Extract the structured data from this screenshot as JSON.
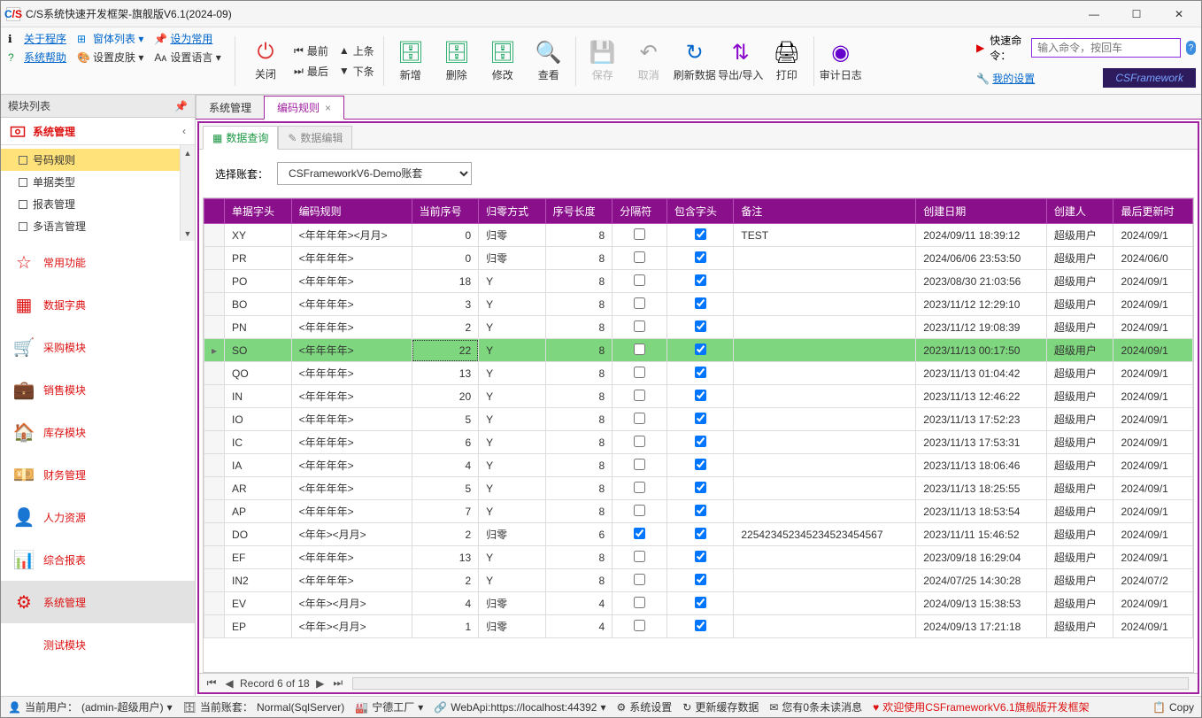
{
  "window": {
    "title": "C/S系统快速开发框架-旗舰版V6.1(2024-09)"
  },
  "ribbon_left": {
    "about": "关于程序",
    "formlist": "窗体列表",
    "set_default": "设为常用",
    "help": "系统帮助",
    "skin": "设置皮肤",
    "lang": "设置语言"
  },
  "ribbon_nav": {
    "first": "最前",
    "prev": "上条",
    "last": "最后",
    "next": "下条"
  },
  "ribbon_btns": {
    "close": "关闭",
    "add": "新增",
    "delete": "删除",
    "modify": "修改",
    "view": "查看",
    "save": "保存",
    "cancel": "取消",
    "refresh": "刷新数据",
    "export": "导出/导入",
    "print": "打印",
    "audit": "审计日志"
  },
  "quick": {
    "label": "快速命令：",
    "placeholder": "输入命令，按回车",
    "settings": "我的设置",
    "badge": "CSFramework"
  },
  "sidebar": {
    "header": "模块列表",
    "group": "系统管理",
    "tree": [
      "号码规则",
      "单据类型",
      "报表管理",
      "多语言管理"
    ],
    "modules": [
      "常用功能",
      "数据字典",
      "采购模块",
      "销售模块",
      "库存模块",
      "财务管理",
      "人力资源",
      "综合报表",
      "系统管理",
      "测试模块"
    ]
  },
  "tabs": {
    "t1": "系统管理",
    "t2": "编码规则"
  },
  "subtabs": {
    "s1": "数据查询",
    "s2": "数据编辑"
  },
  "filter": {
    "label": "选择账套：",
    "value": "CSFrameworkV6-Demo账套"
  },
  "grid": {
    "cols": [
      "单据字头",
      "编码规则",
      "当前序号",
      "归零方式",
      "序号长度",
      "分隔符",
      "包含字头",
      "备注",
      "创建日期",
      "创建人",
      "最后更新时"
    ],
    "rows": [
      {
        "c0": "XY",
        "c1": "<年年年年><月月>",
        "c2": "0",
        "c3": "归零",
        "c4": "8",
        "c5": false,
        "c6": true,
        "c7": "TEST",
        "c8": "2024/09/11 18:39:12",
        "c9": "超级用户",
        "c10": "2024/09/1"
      },
      {
        "c0": "PR",
        "c1": "<年年年年>",
        "c2": "0",
        "c3": "归零",
        "c4": "8",
        "c5": false,
        "c6": true,
        "c7": "",
        "c8": "2024/06/06 23:53:50",
        "c9": "超级用户",
        "c10": "2024/06/0"
      },
      {
        "c0": "PO",
        "c1": "<年年年年>",
        "c2": "18",
        "c3": "Y",
        "c4": "8",
        "c5": false,
        "c6": true,
        "c7": "",
        "c8": "2023/08/30 21:03:56",
        "c9": "超级用户",
        "c10": "2024/09/1"
      },
      {
        "c0": "BO",
        "c1": "<年年年年>",
        "c2": "3",
        "c3": "Y",
        "c4": "8",
        "c5": false,
        "c6": true,
        "c7": "",
        "c8": "2023/11/12 12:29:10",
        "c9": "超级用户",
        "c10": "2024/09/1"
      },
      {
        "c0": "PN",
        "c1": "<年年年年>",
        "c2": "2",
        "c3": "Y",
        "c4": "8",
        "c5": false,
        "c6": true,
        "c7": "",
        "c8": "2023/11/12 19:08:39",
        "c9": "超级用户",
        "c10": "2024/09/1"
      },
      {
        "c0": "SO",
        "c1": "<年年年年>",
        "c2": "22",
        "c3": "Y",
        "c4": "8",
        "c5": false,
        "c6": true,
        "c7": "",
        "c8": "2023/11/13 00:17:50",
        "c9": "超级用户",
        "c10": "2024/09/1",
        "sel": true
      },
      {
        "c0": "QO",
        "c1": "<年年年年>",
        "c2": "13",
        "c3": "Y",
        "c4": "8",
        "c5": false,
        "c6": true,
        "c7": "",
        "c8": "2023/11/13 01:04:42",
        "c9": "超级用户",
        "c10": "2024/09/1"
      },
      {
        "c0": "IN",
        "c1": "<年年年年>",
        "c2": "20",
        "c3": "Y",
        "c4": "8",
        "c5": false,
        "c6": true,
        "c7": "",
        "c8": "2023/11/13 12:46:22",
        "c9": "超级用户",
        "c10": "2024/09/1"
      },
      {
        "c0": "IO",
        "c1": "<年年年年>",
        "c2": "5",
        "c3": "Y",
        "c4": "8",
        "c5": false,
        "c6": true,
        "c7": "",
        "c8": "2023/11/13 17:52:23",
        "c9": "超级用户",
        "c10": "2024/09/1"
      },
      {
        "c0": "IC",
        "c1": "<年年年年>",
        "c2": "6",
        "c3": "Y",
        "c4": "8",
        "c5": false,
        "c6": true,
        "c7": "",
        "c8": "2023/11/13 17:53:31",
        "c9": "超级用户",
        "c10": "2024/09/1"
      },
      {
        "c0": "IA",
        "c1": "<年年年年>",
        "c2": "4",
        "c3": "Y",
        "c4": "8",
        "c5": false,
        "c6": true,
        "c7": "",
        "c8": "2023/11/13 18:06:46",
        "c9": "超级用户",
        "c10": "2024/09/1"
      },
      {
        "c0": "AR",
        "c1": "<年年年年>",
        "c2": "5",
        "c3": "Y",
        "c4": "8",
        "c5": false,
        "c6": true,
        "c7": "",
        "c8": "2023/11/13 18:25:55",
        "c9": "超级用户",
        "c10": "2024/09/1"
      },
      {
        "c0": "AP",
        "c1": "<年年年年>",
        "c2": "7",
        "c3": "Y",
        "c4": "8",
        "c5": false,
        "c6": true,
        "c7": "",
        "c8": "2023/11/13 18:53:54",
        "c9": "超级用户",
        "c10": "2024/09/1"
      },
      {
        "c0": "DO",
        "c1": "<年年><月月>",
        "c2": "2",
        "c3": "归零",
        "c4": "6",
        "c5": true,
        "c6": true,
        "c7": "225423452345234523454567",
        "c8": "2023/11/11 15:46:52",
        "c9": "超级用户",
        "c10": "2024/09/1"
      },
      {
        "c0": "EF",
        "c1": "<年年年年>",
        "c2": "13",
        "c3": "Y",
        "c4": "8",
        "c5": false,
        "c6": true,
        "c7": "",
        "c8": "2023/09/18 16:29:04",
        "c9": "超级用户",
        "c10": "2024/09/1"
      },
      {
        "c0": "IN2",
        "c1": "<年年年年>",
        "c2": "2",
        "c3": "Y",
        "c4": "8",
        "c5": false,
        "c6": true,
        "c7": "",
        "c8": "2024/07/25 14:30:28",
        "c9": "超级用户",
        "c10": "2024/07/2"
      },
      {
        "c0": "EV",
        "c1": "<年年><月月>",
        "c2": "4",
        "c3": "归零",
        "c4": "4",
        "c5": false,
        "c6": true,
        "c7": "",
        "c8": "2024/09/13 15:38:53",
        "c9": "超级用户",
        "c10": "2024/09/1"
      },
      {
        "c0": "EP",
        "c1": "<年年><月月>",
        "c2": "1",
        "c3": "归零",
        "c4": "4",
        "c5": false,
        "c6": true,
        "c7": "",
        "c8": "2024/09/13 17:21:18",
        "c9": "超级用户",
        "c10": "2024/09/1"
      }
    ]
  },
  "nav": {
    "record": "Record 6 of 18"
  },
  "status": {
    "user_label": "当前用户：",
    "user": "(admin-超级用户)",
    "book_label": "当前账套：",
    "book": "Normal(SqlServer)",
    "factory": "宁德工厂",
    "webapi": "WebApi:https://localhost:44392",
    "sys": "系统设置",
    "cache": "更新缓存数据",
    "msg": "您有0条未读消息",
    "welcome": "欢迎使用CSFrameworkV6.1旗舰版开发框架",
    "copy": "Copy"
  }
}
